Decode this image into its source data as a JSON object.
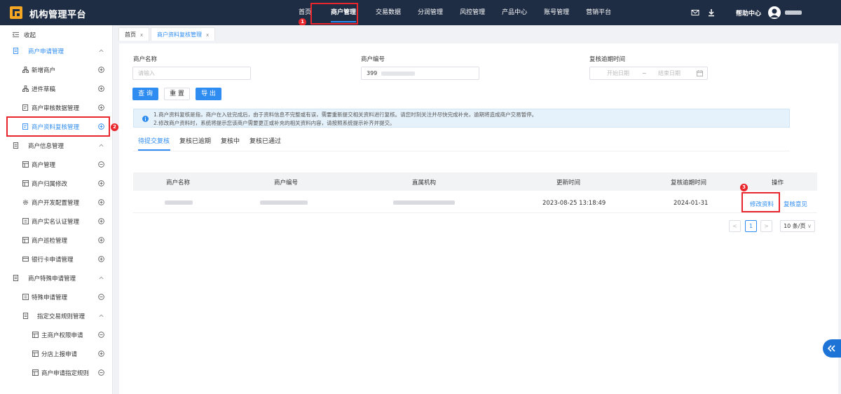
{
  "header": {
    "brand": "机构管理平台",
    "nav": [
      "首页",
      "商户管理",
      "交易数据",
      "分润管理",
      "风控管理",
      "产品中心",
      "账号管理",
      "营销平台"
    ],
    "active_nav": "商户管理",
    "help": "帮助中心",
    "icons": [
      "mail-icon",
      "download-icon",
      "avatar-icon"
    ]
  },
  "steps": [
    "1",
    "2",
    "3"
  ],
  "sidebar": {
    "collapse": "收起",
    "groups": [
      {
        "label": "商户申请管理",
        "items": [
          "新增商户",
          "进件草稿",
          "商户审核数据管理",
          "商户资料复核管理"
        ]
      },
      {
        "label": "商户信息管理",
        "items": [
          "商户管理",
          "商户归属修改",
          "商户开发配置管理",
          "商户实名认证管理",
          "商户巡检管理",
          "银行卡申请管理"
        ]
      },
      {
        "label": "商户特殊申请管理",
        "items": [
          "特殊申请管理",
          "指定交易规则管理",
          "主商户权限申请",
          "分店上报申请",
          "商户申请指定规则"
        ]
      }
    ]
  },
  "tabs": [
    {
      "label": "首页",
      "close": "x"
    },
    {
      "label": "商户资料复核管理",
      "close": "x"
    }
  ],
  "filters": {
    "merchant_name_label": "商户名称",
    "merchant_name_placeholder": "请输入",
    "merchant_no_label": "商户编号",
    "merchant_no_value": "399",
    "deadline_label": "复核逾期时间",
    "start_placeholder": "开始日期",
    "range_sep": "~",
    "end_placeholder": "结束日期"
  },
  "buttons": {
    "query": "查 询",
    "reset": "重 置",
    "export": "导 出"
  },
  "notice": {
    "line1": "1.商户资料复核是指，商户在入驻完成后，由于资料信息不完整或有误，需要重新提交相关资料进行复核。请您时刻关注并尽快完成补充，逾期将造成商户交易暂停。",
    "line2": "2.修改商户资料时，系统将提示您该商户需要更正或补充的相关资料内容，请按照系统提示补齐并提交。"
  },
  "subtabs": [
    "待提交复核",
    "复核已逾期",
    "复核中",
    "复核已通过"
  ],
  "table": {
    "headers": [
      "商户名称",
      "商户编号",
      "直属机构",
      "更新时间",
      "复核逾期时间",
      "操作"
    ],
    "rows": [
      {
        "update_time": "2023-08-25 13:18:49",
        "deadline": "2024-01-31",
        "action_edit": "修改资料",
        "action_opinion": "复核意见"
      }
    ]
  },
  "pagination": {
    "prev": "<",
    "current": "1",
    "next": ">",
    "page_size": "10 条/页"
  },
  "colors": {
    "header_bg": "#1f2d44",
    "primary": "#2f8cf0",
    "highlight": "#e8262c"
  }
}
